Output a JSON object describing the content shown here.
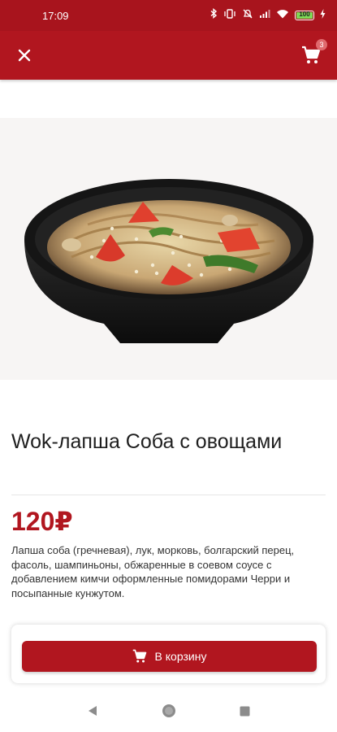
{
  "status_bar": {
    "time": "17:09",
    "battery_level": "100",
    "icons": [
      "bluetooth-icon",
      "vibrate-icon",
      "mute-icon",
      "signal-icon",
      "wifi-icon",
      "battery-icon",
      "charging-icon"
    ]
  },
  "app_bar": {
    "close_icon": "close-icon",
    "cart_icon": "shopping-cart-icon",
    "cart_count": "3"
  },
  "product": {
    "title": "Wok-лапша Соба с овощами",
    "price": "120₽",
    "description": "Лапша соба (гречневая), лук, морковь, болгарский перец, фасоль, шампиньоны, обжаренные в соевом соусе с добавлением кимчи оформленные помидорами Черри и посыпанные кунжутом."
  },
  "actions": {
    "add_to_cart_label": "В корзину",
    "add_to_cart_icon": "shopping-cart-icon"
  },
  "nav_bar": {
    "back_icon": "back-triangle-icon",
    "home_icon": "home-circle-icon",
    "recents_icon": "recents-square-icon"
  },
  "colors": {
    "brand_red": "#b1161f",
    "status_bar": "#a8141d",
    "badge": "#e06a6e"
  }
}
